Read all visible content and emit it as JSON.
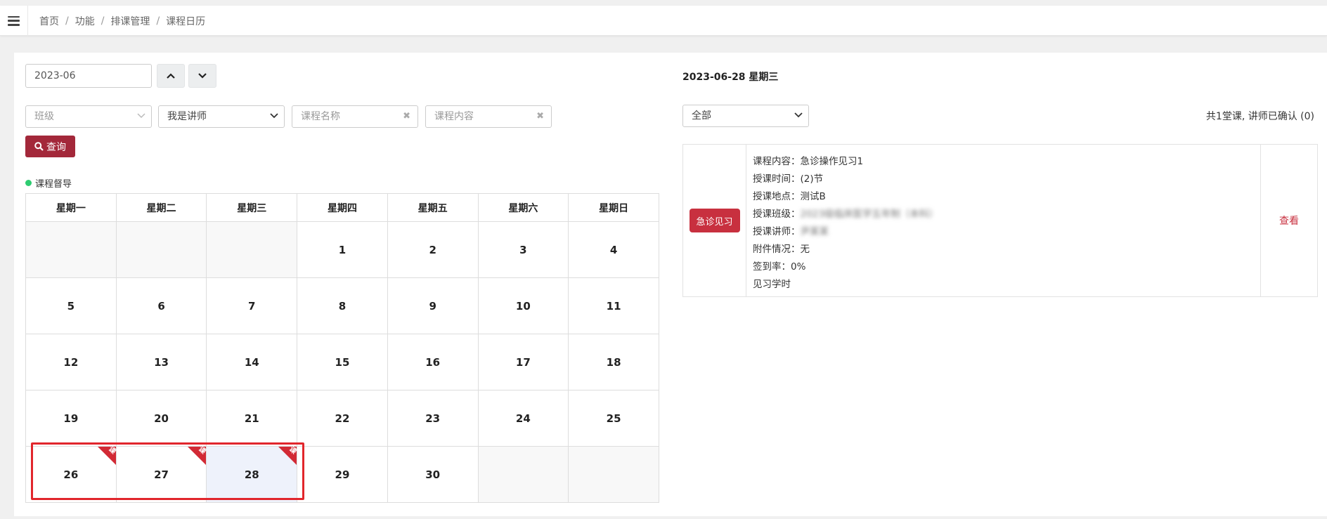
{
  "breadcrumb": [
    "首页",
    "功能",
    "排课管理",
    "课程日历"
  ],
  "left": {
    "month_value": "2023-06",
    "filters": {
      "class_placeholder": "班级",
      "role_value": "我是讲师",
      "course_name_placeholder": "课程名称",
      "course_content_placeholder": "课程内容"
    },
    "query_label": "查询",
    "legend_label": "课程督导"
  },
  "calendar": {
    "weekdays": [
      "星期一",
      "星期二",
      "星期三",
      "星期四",
      "星期五",
      "星期六",
      "星期日"
    ],
    "weeks": [
      [
        "",
        "",
        "",
        "1",
        "2",
        "3",
        "4"
      ],
      [
        "5",
        "6",
        "7",
        "8",
        "9",
        "10",
        "11"
      ],
      [
        "12",
        "13",
        "14",
        "15",
        "16",
        "17",
        "18"
      ],
      [
        "19",
        "20",
        "21",
        "22",
        "23",
        "24",
        "25"
      ],
      [
        "26",
        "27",
        "28",
        "29",
        "30",
        "",
        ""
      ]
    ],
    "course_days": [
      "26",
      "27",
      "28"
    ],
    "selected_day": "28",
    "ribbon_text": "课"
  },
  "right": {
    "date_title": "2023-06-28 星期三",
    "status_value": "全部",
    "summary": "共1堂课, 讲师已确认 (0)",
    "course": {
      "tag": "急诊见习",
      "lines": [
        "课程内容：急诊操作见习1",
        "授课时间：(2)节",
        "授课地点：测试B"
      ],
      "class_label": "授课班级：",
      "class_value": "2023级临床医学五年制（本科）",
      "teacher_label": "授课讲师：",
      "teacher_value": "尹某某",
      "lines_after": [
        "附件情况：无",
        "签到率：0%",
        "见习学时"
      ],
      "view_label": "查看"
    }
  },
  "colors": {
    "primary": "#a3283a",
    "ribbon": "#d22a35",
    "highlight": "#e1262c",
    "legend_dot": "#2ecc71"
  }
}
